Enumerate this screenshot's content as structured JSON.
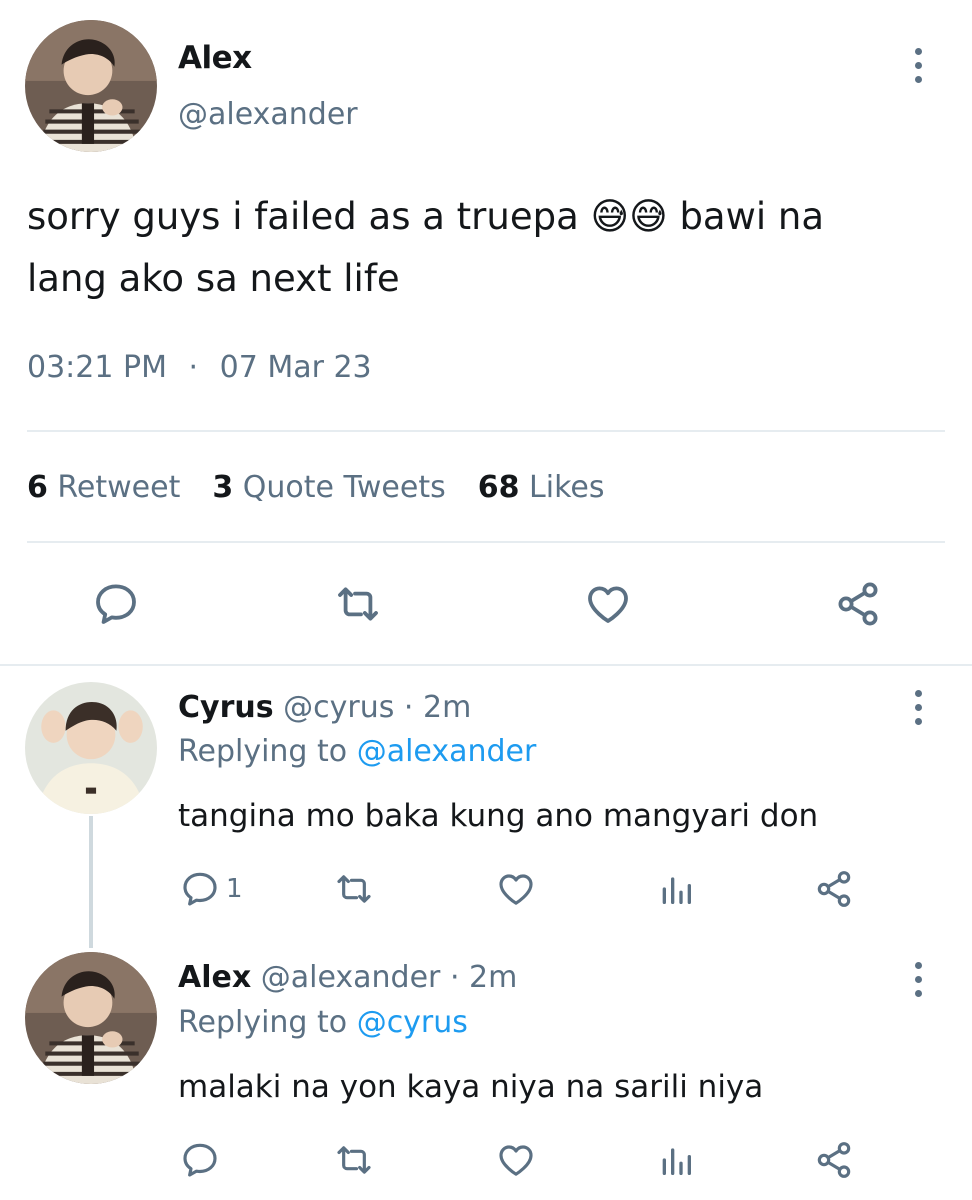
{
  "main_tweet": {
    "display_name": "Alex",
    "handle": "@alexander",
    "text_part1": "sorry guys i failed as a truepa ",
    "emoji1": "😅",
    "emoji2": "😅",
    "text_part2": " bawi na",
    "text_line2": "lang ako sa next life",
    "time": "03:21 PM",
    "dot": "·",
    "date": "07 Mar 23",
    "stats": {
      "retweets_count": "6",
      "retweets_label": "Retweet",
      "quotes_count": "3",
      "quotes_label": "Quote Tweets",
      "likes_count": "68",
      "likes_label": "Likes"
    }
  },
  "replies": [
    {
      "display_name": "Cyrus",
      "handle": "@cyrus",
      "time": "· 2m",
      "replying_label": "Replying to",
      "replying_to": "@alexander",
      "text": "tangina mo baka kung ano mangyari don",
      "reply_count": "1"
    },
    {
      "display_name": "Alex",
      "handle": "@alexander",
      "time": "· 2m",
      "replying_label": "Replying to",
      "replying_to": "@cyrus",
      "text": "malaki na yon kaya niya na sarili niya",
      "reply_count": ""
    }
  ],
  "colors": {
    "text": "#14171a",
    "secondary": "#5b7083",
    "link": "#1d9bf0",
    "divider": "#e6ecf0"
  },
  "icons": [
    "more-icon",
    "reply-icon",
    "retweet-icon",
    "like-icon",
    "share-icon",
    "analytics-icon"
  ]
}
